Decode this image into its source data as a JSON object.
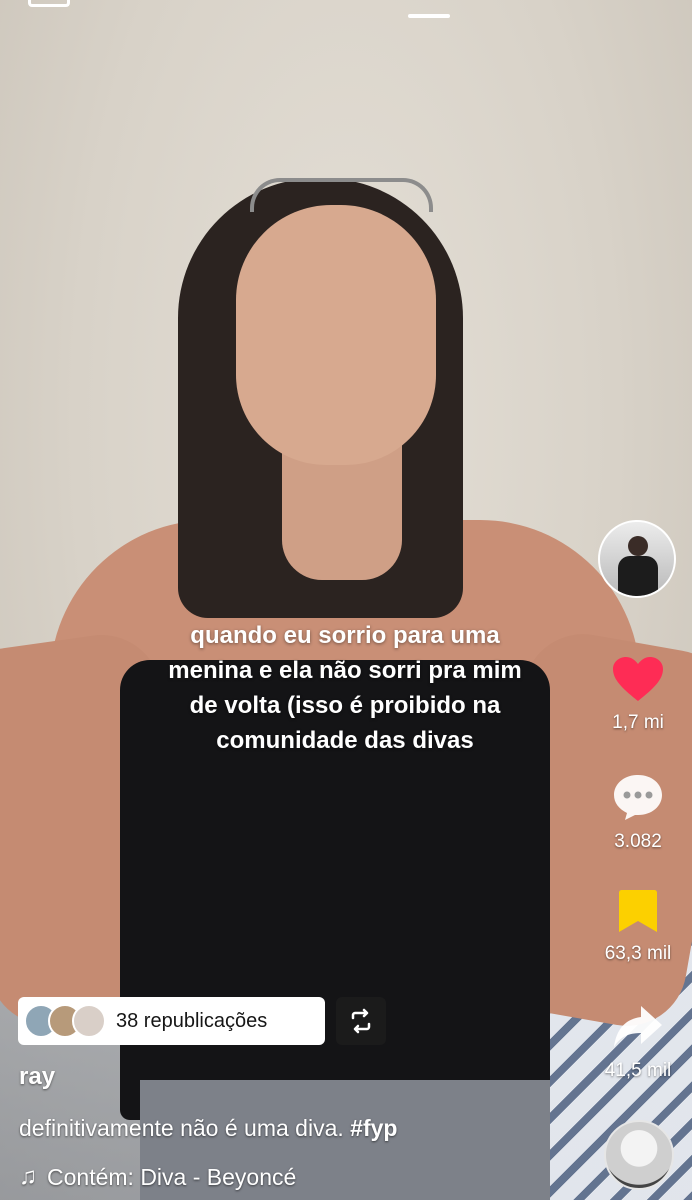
{
  "overlay_caption": {
    "line1": "quando eu sorrio para uma",
    "line2": "menina e ela não sorri pra mim",
    "line3": "de volta (isso é proibido na",
    "line4": "comunidade das divas"
  },
  "actions": {
    "likes": "1,7 mi",
    "comments": "3.082",
    "saves": "63,3 mil",
    "shares": "41,5 mil"
  },
  "reposts": {
    "label": "38 republicações"
  },
  "post": {
    "username": "ray",
    "description": "definitivamente não é uma diva.",
    "hashtag": "#fyp",
    "music": "Contém: Diva - Beyoncé"
  },
  "colors": {
    "like": "#fe2c55",
    "save": "#fcd000",
    "text": "#ffffff"
  },
  "icons": {
    "like": "heart-icon",
    "comment": "comment-icon",
    "save": "bookmark-icon",
    "share": "share-icon",
    "music": "music-note-icon",
    "repost": "repost-icon"
  }
}
